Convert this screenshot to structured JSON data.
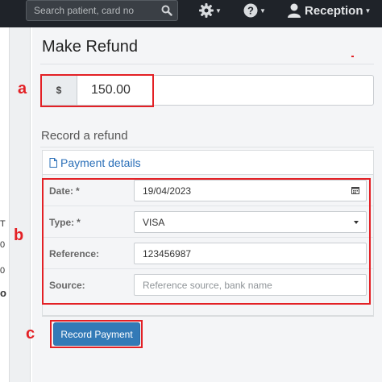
{
  "navbar": {
    "search_placeholder": "Search patient, card no",
    "user_label": "Reception",
    "icons": [
      "search-icon",
      "gear-icon",
      "help-icon",
      "user-icon"
    ]
  },
  "left_fragments": [
    "T",
    "0",
    "0",
    "o"
  ],
  "page": {
    "title": "Make Refund",
    "currency_symbol": "$",
    "amount": "150.00",
    "section_title": "Record a refund",
    "tab_label": "Payment details"
  },
  "form": {
    "date_label": "Date:",
    "date_value": "19/04/2023",
    "type_label": "Type:",
    "type_value": "VISA",
    "reference_label": "Reference:",
    "reference_value": "123456987",
    "source_label": "Source:",
    "source_placeholder": "Reference source, bank name",
    "required_mark": "*"
  },
  "actions": {
    "record_label": "Record Payment"
  },
  "annotations": {
    "a": "a",
    "b": "b",
    "c": "c"
  },
  "colors": {
    "navbar": "#1f2329",
    "primary": "#337ab7",
    "link": "#2a6fb8",
    "annotation": "#e32025"
  }
}
